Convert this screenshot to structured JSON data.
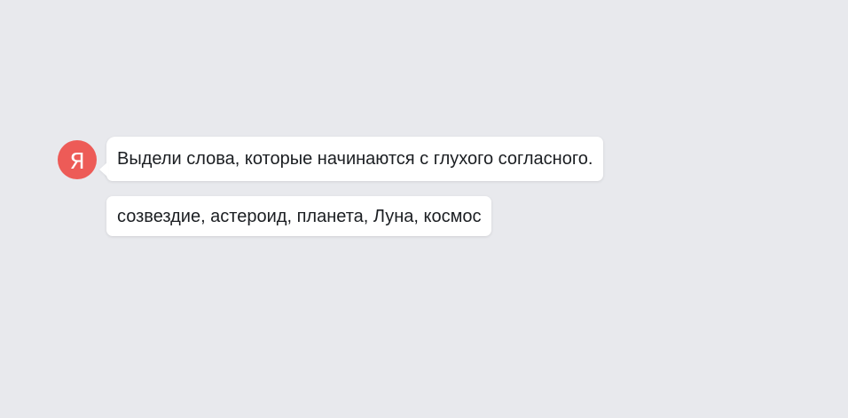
{
  "assistant": {
    "avatar_letter": "Я",
    "brand_color": "#ed5b57"
  },
  "messages": {
    "prompt": "Выдели слова, которые начинаются с глухого согласного.",
    "words": "созвездие, астероид, планета, Луна, космос"
  }
}
